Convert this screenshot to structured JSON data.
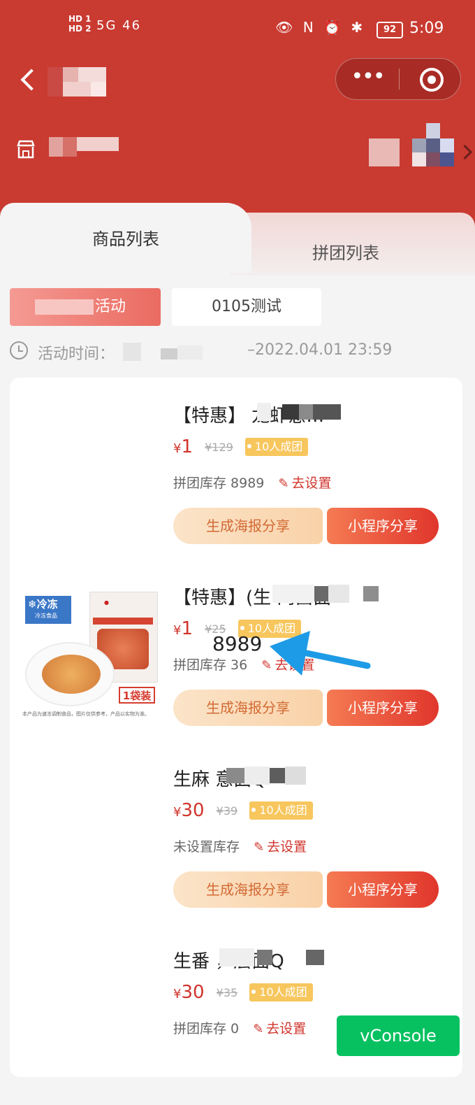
{
  "status_bar": {
    "hd1": "HD 1",
    "hd2": "HD 2",
    "left_icons": "5G 46",
    "right_icons": "👁 N ⏰ ✱",
    "battery": "92",
    "time": "5:09"
  },
  "nav": {
    "more": "•••"
  },
  "tabs": {
    "left": "商品列表",
    "right": "拼团列表"
  },
  "activities": {
    "active_tail": "活动",
    "test": "0105测试"
  },
  "activity_time": {
    "label": "活动时间：",
    "value": "–2022.04.01 23:59"
  },
  "products": [
    {
      "title": "【特惠】                    龙虾意…",
      "price": "1",
      "orig": "¥129",
      "badge": "10人成团",
      "stock": "拼团库存 8989",
      "edit": "去设置",
      "poster_btn": "生成海报分享",
      "share_btn": "小程序分享"
    },
    {
      "title": "【特惠】(生                       肉酱面",
      "price": "1",
      "orig": "¥25",
      "badge": "10人成团",
      "stock": "拼团库存 36",
      "edit": "去设置",
      "poster_btn": "生成海报分享",
      "share_btn": "小程序分享",
      "image": {
        "frozen": "冷冻",
        "frozen_sub": "冷冻食品",
        "bag": "1袋装",
        "note": "本产品为速冻调制食品，图片仅供参考，产品以实物为准。"
      }
    },
    {
      "title": "生麻                    意面Q",
      "price": "30",
      "orig": "¥39",
      "badge": "10人成团",
      "stock": "未设置库存",
      "edit": "去设置",
      "poster_btn": "生成海报分享",
      "share_btn": "小程序分享"
    },
    {
      "title": "生番              ，层面Q",
      "price": "30",
      "orig": "¥35",
      "badge": "10人成团",
      "stock": "拼团库存 0",
      "edit": "去设置"
    }
  ],
  "annotation": {
    "number": "8989",
    "color": "#1e9be6"
  },
  "vconsole": "vConsole",
  "colors": {
    "brand_red": "#c93a31",
    "price_red": "#d0342c",
    "badge": "#f7c65d",
    "vconsole": "#07c160"
  }
}
